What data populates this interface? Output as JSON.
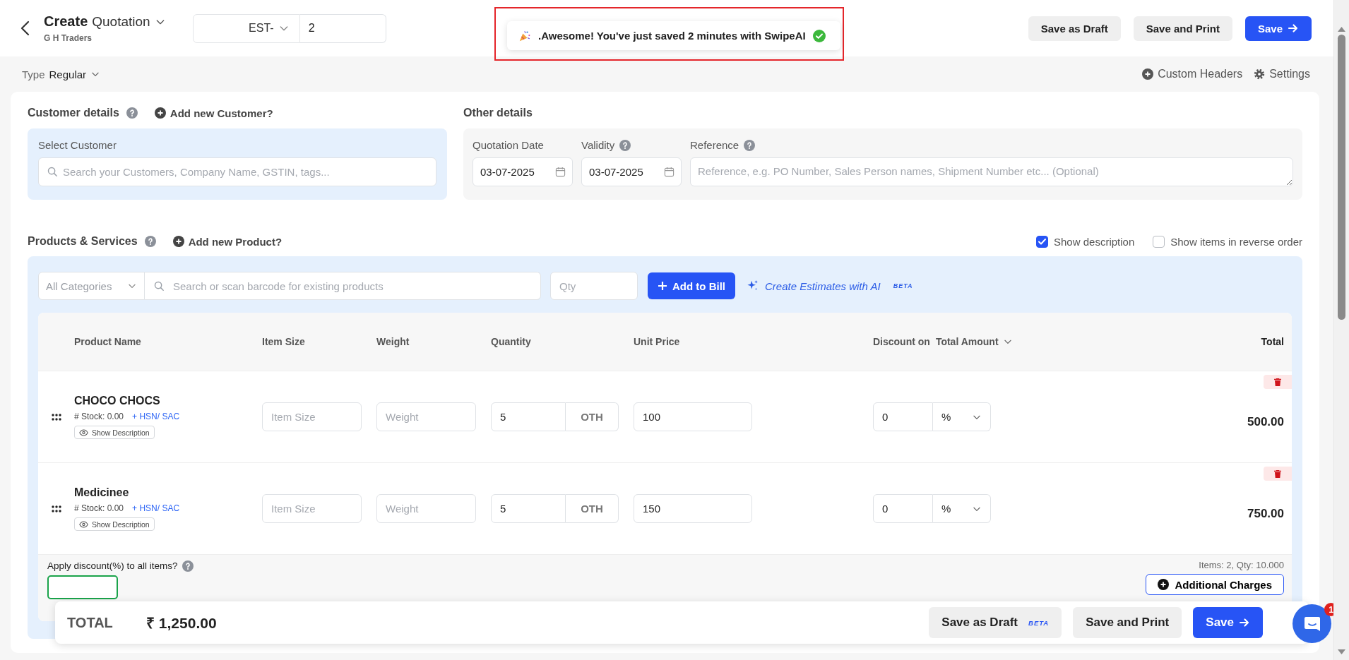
{
  "header": {
    "title": "Create",
    "document_type": "Quotation",
    "company": "G H Traders",
    "prefix": "EST-",
    "number": "2"
  },
  "toast": {
    "text": ".Awesome! You've just saved 2 minutes with SwipeAI",
    "highlighted": true
  },
  "header_buttons": [
    {
      "label": "Save as Draft",
      "kind": "secondary"
    },
    {
      "label": "Save and Print",
      "kind": "secondary"
    },
    {
      "label": "Save",
      "kind": "primary"
    }
  ],
  "type": {
    "label": "Type",
    "value": "Regular"
  },
  "top_links": [
    {
      "label": "Custom Headers",
      "kind": "add"
    },
    {
      "label": "Settings",
      "kind": "gear"
    }
  ],
  "customer": {
    "title": "Customer details",
    "help": true,
    "add_link": "Add new Customer?",
    "box_label": "Select Customer",
    "placeholder": "Search your Customers, Company Name, GSTIN, tags..."
  },
  "other_details": {
    "title": "Other details",
    "fields": [
      {
        "label": "Quotation Date",
        "kind": "date",
        "help": false,
        "value": "03-07-2025"
      },
      {
        "label": "Validity",
        "kind": "date",
        "help": true,
        "value": "03-07-2025"
      },
      {
        "label": "Reference",
        "kind": "textarea",
        "help": true,
        "placeholder": "Reference, e.g. PO Number, Sales Person names, Shipment Number etc... (Optional)"
      }
    ]
  },
  "products": {
    "title": "Products & Services",
    "help": true,
    "add_link": "Add new Product?",
    "options": [
      {
        "label": "Show description",
        "checked": true
      },
      {
        "label": "Show items in reverse order",
        "checked": false
      }
    ],
    "category": "All Categories",
    "search_placeholder": "Search or scan barcode for existing products",
    "qty_placeholder": "Qty",
    "add_button": "Add to Bill",
    "ai_link": "Create Estimates with AI",
    "ai_badge": "BETA",
    "columns": [
      "Product Name",
      "Item Size",
      "Weight",
      "Quantity",
      "Unit Price",
      "Discount on",
      "Total"
    ],
    "discount_mode": "Total Amount",
    "rows": [
      {
        "name": "CHOCO CHOCS",
        "stock": "# Stock: 0.00",
        "hsn": "+ HSN/ SAC",
        "desc_button": "Show Description",
        "item_size_placeholder": "Item Size",
        "weight_placeholder": "Weight",
        "quantity": "5",
        "unit": "OTH",
        "unit_price": "100",
        "discount": "0",
        "discount_unit": "%",
        "total": "500.00"
      },
      {
        "name": "Medicinee",
        "stock": "# Stock: 0.00",
        "hsn": "+ HSN/ SAC",
        "desc_button": "Show Description",
        "item_size_placeholder": "Item Size",
        "weight_placeholder": "Weight",
        "quantity": "5",
        "unit": "OTH",
        "unit_price": "150",
        "discount": "0",
        "discount_unit": "%",
        "total": "750.00"
      }
    ],
    "apply_discount_label": "Apply discount(%) to all items?",
    "apply_discount_help": true,
    "summary": "Items: 2, Qty: 10.000",
    "additional_charges": "Additional Charges"
  },
  "footer": {
    "label": "TOTAL",
    "amount": "₹ 1,250.00",
    "buttons": [
      {
        "label": "Save as Draft",
        "kind": "secondary",
        "badge": "BETA"
      },
      {
        "label": "Save and Print",
        "kind": "secondary"
      },
      {
        "label": "Save",
        "kind": "primary"
      }
    ]
  },
  "chat": {
    "badge": "1"
  }
}
